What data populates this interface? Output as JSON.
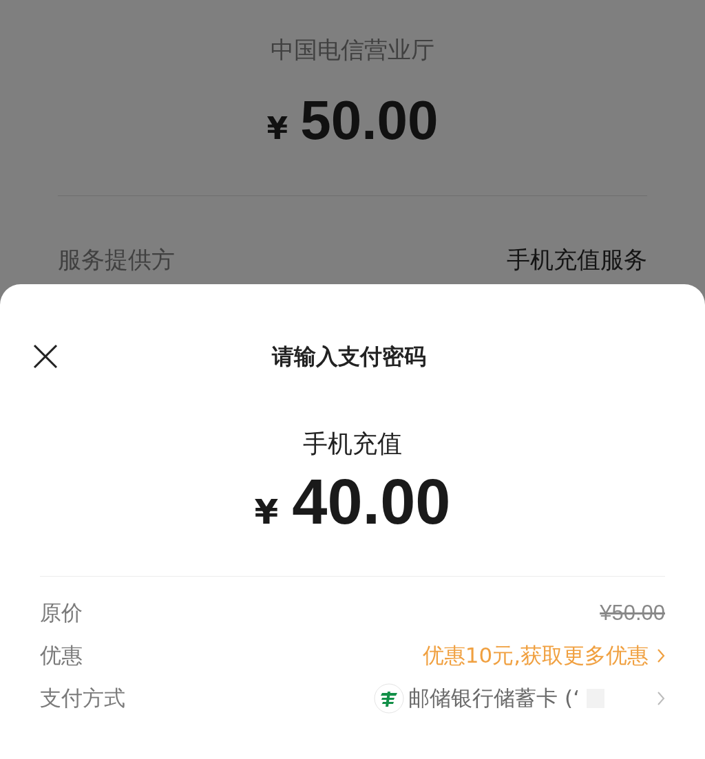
{
  "background_page": {
    "merchant": "中国电信营业厅",
    "currency": "¥",
    "amount": "50.00",
    "rows": [
      {
        "label": "服务提供方",
        "value": "手机充值服务"
      }
    ]
  },
  "payment_sheet": {
    "title": "请输入支付密码",
    "item": "手机充值",
    "currency": "¥",
    "amount": "40.00",
    "details": [
      {
        "kind": "strike",
        "label": "原价",
        "value": "¥50.00"
      },
      {
        "kind": "promo",
        "label": "优惠",
        "value": "优惠10元,获取更多优惠"
      },
      {
        "kind": "method",
        "label": "支付方式",
        "value": "邮储银行储蓄卡 (‘"
      }
    ]
  }
}
